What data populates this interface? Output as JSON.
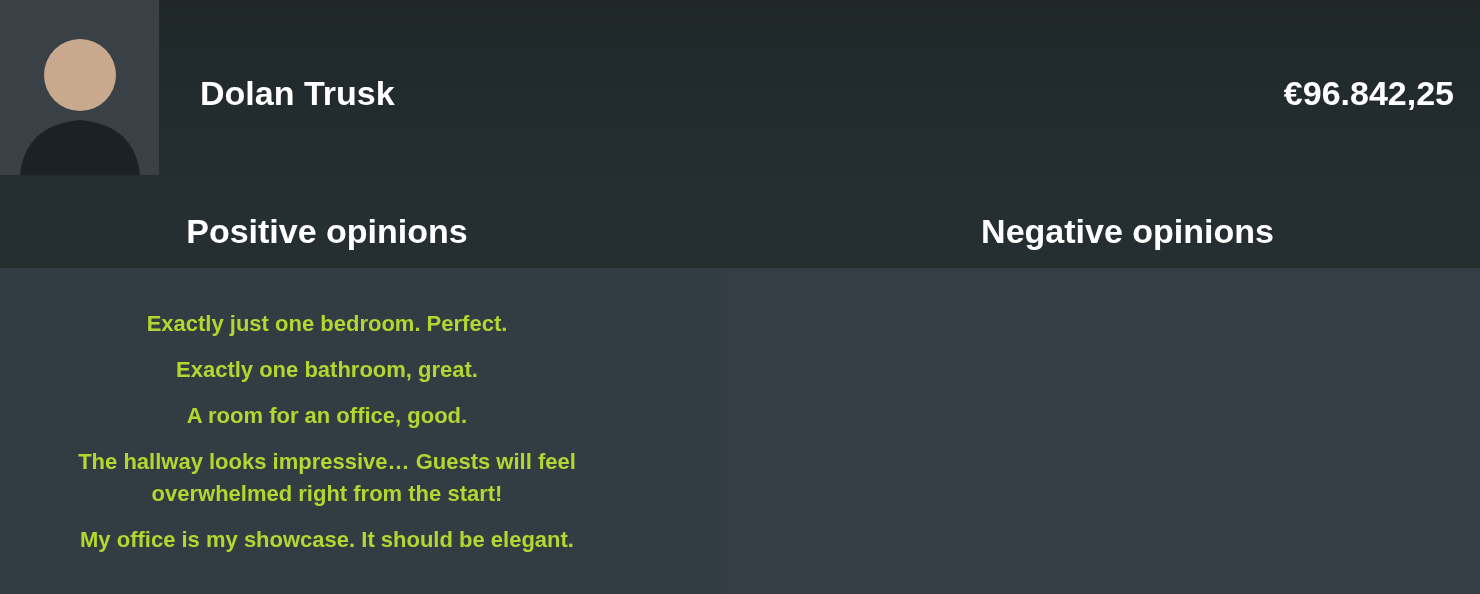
{
  "client": {
    "name": "Dolan Trusk",
    "budget": "€96.842,25"
  },
  "columns": [
    {
      "heading": "Positive opinions",
      "kind": "positive",
      "opinions": [
        "Exactly just one bedroom. Perfect.",
        "Exactly one bathroom, great.",
        "A room for an office, good.",
        "The hallway looks impressive… Guests will feel overwhelmed right from the start!",
        "My office is my showcase. It should be elegant."
      ]
    },
    {
      "heading": "Negative opinions"
    }
  ]
}
